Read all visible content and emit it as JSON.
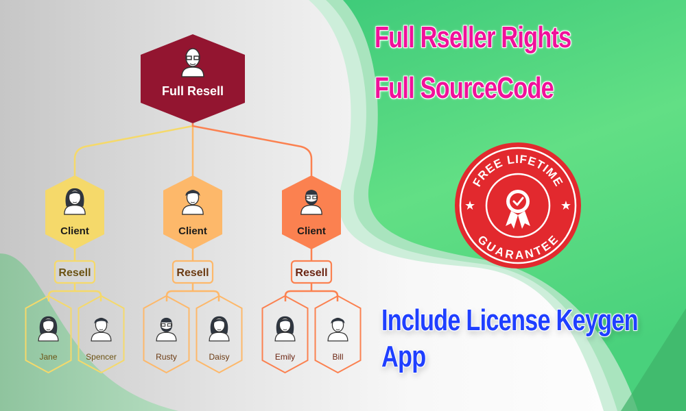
{
  "headlines": {
    "line1": "Full Rseller Rights",
    "line2": "Full SourceCode",
    "line3": "Include License Keygen",
    "line4": "App"
  },
  "badge": {
    "top_text": "FREE LIFETIME",
    "bottom_text": "GUARANTEE",
    "icon": "award-ribbon-check-icon",
    "color": "#e2292e"
  },
  "diagram": {
    "root": {
      "label": "Full Resell",
      "icon": "bald-man-glasses-avatar",
      "color": "#931530"
    },
    "branches": [
      {
        "label": "Client",
        "resell_label": "Resell",
        "color": "#f5d96a",
        "text_color": "#6b5212",
        "avatar": "woman-avatar",
        "children": [
          {
            "name": "Jane",
            "avatar": "woman-avatar"
          },
          {
            "name": "Spencer",
            "avatar": "man-avatar"
          }
        ]
      },
      {
        "label": "Client",
        "resell_label": "Resell",
        "color": "#fdb86a",
        "text_color": "#6b3a12",
        "avatar": "man-avatar",
        "children": [
          {
            "name": "Rusty",
            "avatar": "bearded-man-avatar"
          },
          {
            "name": "Daisy",
            "avatar": "woman-avatar"
          }
        ]
      },
      {
        "label": "Client",
        "resell_label": "Resell",
        "color": "#fb8150",
        "text_color": "#6b2512",
        "avatar": "bearded-man-avatar",
        "children": [
          {
            "name": "Emily",
            "avatar": "woman-avatar"
          },
          {
            "name": "Bill",
            "avatar": "man-avatar"
          }
        ]
      }
    ]
  },
  "colors": {
    "green": "#4fd37f",
    "pink": "#f0119a",
    "blue": "#1f3fff"
  }
}
